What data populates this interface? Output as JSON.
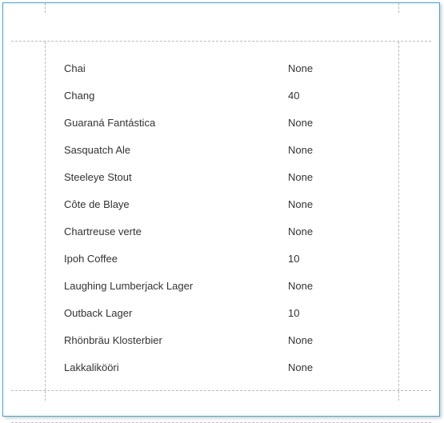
{
  "rows": [
    {
      "name": "Chai",
      "value": "None"
    },
    {
      "name": "Chang",
      "value": "40"
    },
    {
      "name": "Guaraná Fantástica",
      "value": "None"
    },
    {
      "name": "Sasquatch Ale",
      "value": "None"
    },
    {
      "name": "Steeleye Stout",
      "value": "None"
    },
    {
      "name": "Côte de Blaye",
      "value": "None"
    },
    {
      "name": "Chartreuse verte",
      "value": "None"
    },
    {
      "name": "Ipoh Coffee",
      "value": "10"
    },
    {
      "name": "Laughing Lumberjack Lager",
      "value": "None"
    },
    {
      "name": "Outback Lager",
      "value": "10"
    },
    {
      "name": "Rhönbräu Klosterbier",
      "value": "None"
    },
    {
      "name": "Lakkalikööri",
      "value": "None"
    }
  ]
}
